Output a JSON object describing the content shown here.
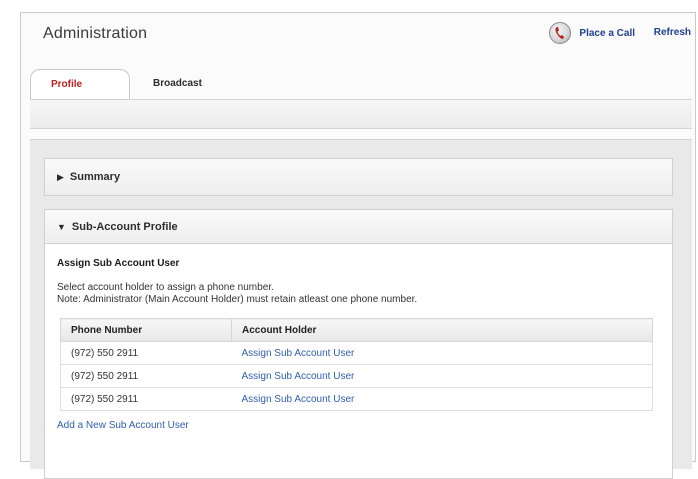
{
  "header": {
    "title": "Administration",
    "place_call_label": "Place a Call",
    "refresh_label": "Refresh"
  },
  "tabs": [
    {
      "label": "Profile",
      "active": true
    },
    {
      "label": "Broadcast",
      "active": false
    }
  ],
  "summary_panel": {
    "title": "Summary",
    "expanded": false
  },
  "sub_account_panel": {
    "title": "Sub-Account Profile",
    "expanded": true,
    "section_title": "Assign Sub Account User",
    "description_line1": "Select account holder to assign a phone number.",
    "description_line2": "Note: Administrator (Main Account Holder) must retain atleast one phone number.",
    "table": {
      "columns": [
        "Phone Number",
        "Account Holder"
      ],
      "rows": [
        {
          "phone": "(972) 550 2911",
          "holder": "Assign Sub Account User"
        },
        {
          "phone": "(972) 550 2911",
          "holder": "Assign Sub Account User"
        },
        {
          "phone": "(972) 550 2911",
          "holder": "Assign Sub Account User"
        }
      ]
    },
    "add_link": "Add a New Sub Account User"
  },
  "colors": {
    "active_tab": "#c01f1f",
    "link": "#2f5fae",
    "header_link": "#1f3f8f"
  },
  "icons": {
    "place_call": "phone-icon",
    "summary_toggle": "triangle-right-icon",
    "sub_account_toggle": "triangle-down-icon"
  }
}
